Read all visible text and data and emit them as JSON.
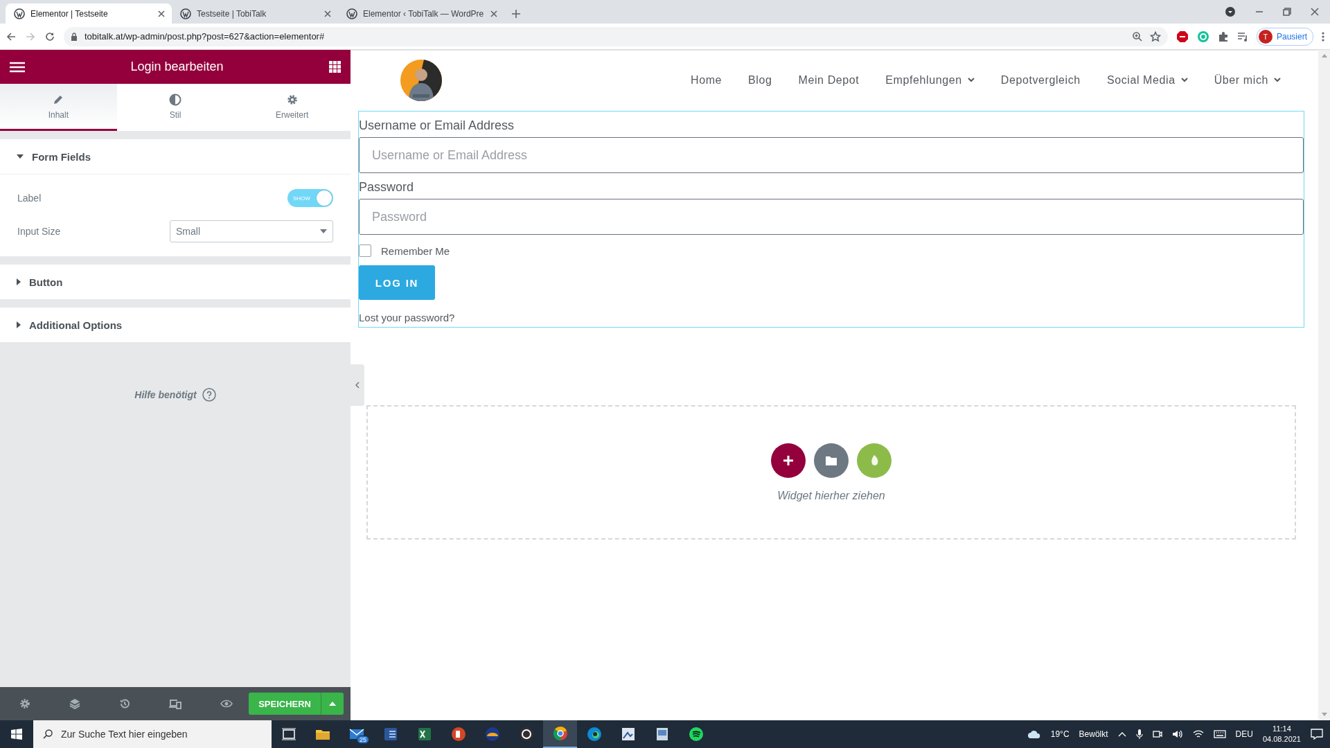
{
  "browser": {
    "tabs": [
      {
        "title": "Elementor | Testseite",
        "selected": true
      },
      {
        "title": "Testseite | TobiTalk",
        "selected": false
      },
      {
        "title": "Elementor ‹ TobiTalk — WordPre",
        "selected": false
      }
    ],
    "url": "tobitalk.at/wp-admin/post.php?post=627&action=elementor#",
    "profile": {
      "initial": "T",
      "label": "Pausiert"
    }
  },
  "editor": {
    "title": "Login bearbeiten",
    "tabs": [
      {
        "label": "Inhalt",
        "selected": true
      },
      {
        "label": "Stil",
        "selected": false
      },
      {
        "label": "Erweitert",
        "selected": false
      }
    ],
    "sections": [
      {
        "title": "Form Fields",
        "expanded": true,
        "controls": [
          {
            "kind": "switch",
            "label": "Label",
            "on": true,
            "switch_text": "SHOW"
          },
          {
            "kind": "select",
            "label": "Input Size",
            "value": "Small"
          }
        ]
      },
      {
        "title": "Button",
        "expanded": false
      },
      {
        "title": "Additional Options",
        "expanded": false
      }
    ],
    "help": "Hilfe benötigt",
    "save_button": "SPEICHERN"
  },
  "site": {
    "nav": [
      {
        "label": "Home",
        "dropdown": false
      },
      {
        "label": "Blog",
        "dropdown": false
      },
      {
        "label": "Mein Depot",
        "dropdown": false
      },
      {
        "label": "Empfehlungen",
        "dropdown": true
      },
      {
        "label": "Depotvergleich",
        "dropdown": false
      },
      {
        "label": "Social Media",
        "dropdown": true
      },
      {
        "label": "Über mich",
        "dropdown": true
      }
    ],
    "login": {
      "fields": [
        {
          "label": "Username or Email Address",
          "placeholder": "Username or Email Address"
        },
        {
          "label": "Password",
          "placeholder": "Password"
        }
      ],
      "remember": {
        "label": "Remember Me",
        "checked": false
      },
      "button": "LOG IN",
      "lost_password": "Lost your password?"
    },
    "drop_zone": {
      "text": "Widget hierher ziehen"
    }
  },
  "taskbar": {
    "search_placeholder": "Zur Suche Text hier eingeben",
    "apps": [
      {
        "active": false
      },
      {
        "active": false
      },
      {
        "active": false,
        "badge": "25"
      },
      {
        "active": false
      },
      {
        "active": false
      },
      {
        "active": false
      },
      {
        "active": false
      },
      {
        "active": false
      },
      {
        "active": true
      },
      {
        "active": false
      },
      {
        "active": false
      },
      {
        "active": false
      },
      {
        "active": false
      }
    ],
    "temperature": "19°C",
    "weather": "Bewölkt",
    "language": "DEU",
    "time": "11:14",
    "date": "04.08.2021"
  }
}
